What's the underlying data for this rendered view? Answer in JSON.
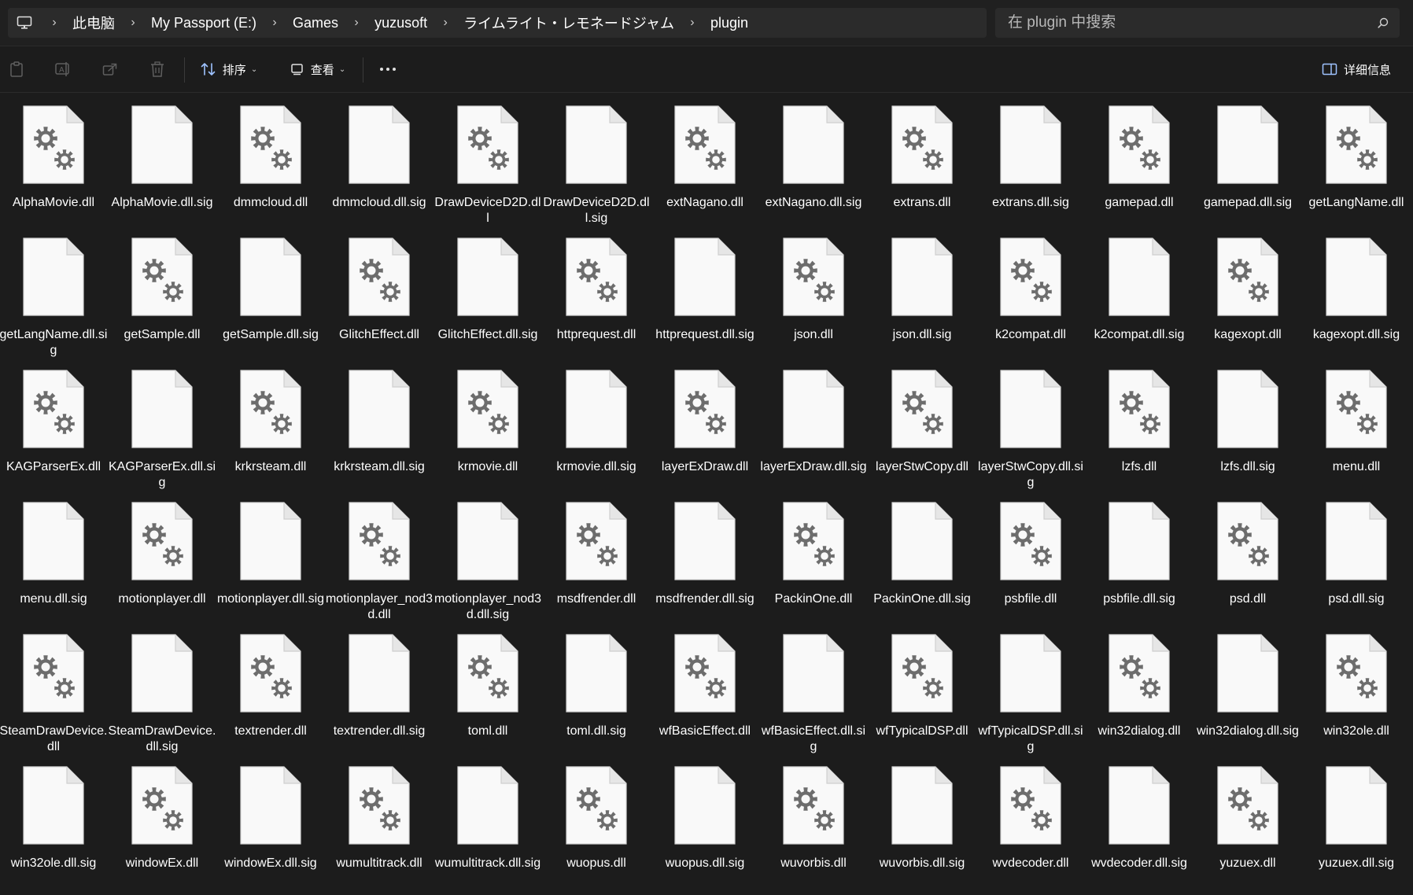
{
  "breadcrumb": [
    "此电脑",
    "My Passport (E:)",
    "Games",
    "yuzusoft",
    "ライムライト・レモネードジャム",
    "plugin"
  ],
  "search": {
    "placeholder": "在 plugin 中搜索"
  },
  "toolbar": {
    "sort_label": "排序",
    "view_label": "查看",
    "details_label": "详细信息"
  },
  "files": [
    {
      "name": "AlphaMovie.dll",
      "type": "dll"
    },
    {
      "name": "AlphaMovie.dll.sig",
      "type": "sig"
    },
    {
      "name": "dmmcloud.dll",
      "type": "dll"
    },
    {
      "name": "dmmcloud.dll.sig",
      "type": "sig"
    },
    {
      "name": "DrawDeviceD2D.dll",
      "type": "dll"
    },
    {
      "name": "DrawDeviceD2D.dll.sig",
      "type": "sig"
    },
    {
      "name": "extNagano.dll",
      "type": "dll"
    },
    {
      "name": "extNagano.dll.sig",
      "type": "sig"
    },
    {
      "name": "extrans.dll",
      "type": "dll"
    },
    {
      "name": "extrans.dll.sig",
      "type": "sig"
    },
    {
      "name": "gamepad.dll",
      "type": "dll"
    },
    {
      "name": "gamepad.dll.sig",
      "type": "sig"
    },
    {
      "name": "getLangName.dll",
      "type": "dll"
    },
    {
      "name": "getLangName.dll.sig",
      "type": "sig"
    },
    {
      "name": "getSample.dll",
      "type": "dll"
    },
    {
      "name": "getSample.dll.sig",
      "type": "sig"
    },
    {
      "name": "GlitchEffect.dll",
      "type": "dll"
    },
    {
      "name": "GlitchEffect.dll.sig",
      "type": "sig"
    },
    {
      "name": "httprequest.dll",
      "type": "dll"
    },
    {
      "name": "httprequest.dll.sig",
      "type": "sig"
    },
    {
      "name": "json.dll",
      "type": "dll"
    },
    {
      "name": "json.dll.sig",
      "type": "sig"
    },
    {
      "name": "k2compat.dll",
      "type": "dll"
    },
    {
      "name": "k2compat.dll.sig",
      "type": "sig"
    },
    {
      "name": "kagexopt.dll",
      "type": "dll"
    },
    {
      "name": "kagexopt.dll.sig",
      "type": "sig"
    },
    {
      "name": "KAGParserEx.dll",
      "type": "dll"
    },
    {
      "name": "KAGParserEx.dll.sig",
      "type": "sig"
    },
    {
      "name": "krkrsteam.dll",
      "type": "dll"
    },
    {
      "name": "krkrsteam.dll.sig",
      "type": "sig"
    },
    {
      "name": "krmovie.dll",
      "type": "dll"
    },
    {
      "name": "krmovie.dll.sig",
      "type": "sig"
    },
    {
      "name": "layerExDraw.dll",
      "type": "dll"
    },
    {
      "name": "layerExDraw.dll.sig",
      "type": "sig"
    },
    {
      "name": "layerStwCopy.dll",
      "type": "dll"
    },
    {
      "name": "layerStwCopy.dll.sig",
      "type": "sig"
    },
    {
      "name": "lzfs.dll",
      "type": "dll"
    },
    {
      "name": "lzfs.dll.sig",
      "type": "sig"
    },
    {
      "name": "menu.dll",
      "type": "dll"
    },
    {
      "name": "menu.dll.sig",
      "type": "sig"
    },
    {
      "name": "motionplayer.dll",
      "type": "dll"
    },
    {
      "name": "motionplayer.dll.sig",
      "type": "sig"
    },
    {
      "name": "motionplayer_nod3d.dll",
      "type": "dll"
    },
    {
      "name": "motionplayer_nod3d.dll.sig",
      "type": "sig"
    },
    {
      "name": "msdfrender.dll",
      "type": "dll"
    },
    {
      "name": "msdfrender.dll.sig",
      "type": "sig"
    },
    {
      "name": "PackinOne.dll",
      "type": "dll"
    },
    {
      "name": "PackinOne.dll.sig",
      "type": "sig"
    },
    {
      "name": "psbfile.dll",
      "type": "dll"
    },
    {
      "name": "psbfile.dll.sig",
      "type": "sig"
    },
    {
      "name": "psd.dll",
      "type": "dll"
    },
    {
      "name": "psd.dll.sig",
      "type": "sig"
    },
    {
      "name": "SteamDrawDevice.dll",
      "type": "dll"
    },
    {
      "name": "SteamDrawDevice.dll.sig",
      "type": "sig"
    },
    {
      "name": "textrender.dll",
      "type": "dll"
    },
    {
      "name": "textrender.dll.sig",
      "type": "sig"
    },
    {
      "name": "toml.dll",
      "type": "dll"
    },
    {
      "name": "toml.dll.sig",
      "type": "sig"
    },
    {
      "name": "wfBasicEffect.dll",
      "type": "dll"
    },
    {
      "name": "wfBasicEffect.dll.sig",
      "type": "sig"
    },
    {
      "name": "wfTypicalDSP.dll",
      "type": "dll"
    },
    {
      "name": "wfTypicalDSP.dll.sig",
      "type": "sig"
    },
    {
      "name": "win32dialog.dll",
      "type": "dll"
    },
    {
      "name": "win32dialog.dll.sig",
      "type": "sig"
    },
    {
      "name": "win32ole.dll",
      "type": "dll"
    },
    {
      "name": "win32ole.dll.sig",
      "type": "sig"
    },
    {
      "name": "windowEx.dll",
      "type": "dll"
    },
    {
      "name": "windowEx.dll.sig",
      "type": "sig"
    },
    {
      "name": "wumultitrack.dll",
      "type": "dll"
    },
    {
      "name": "wumultitrack.dll.sig",
      "type": "sig"
    },
    {
      "name": "wuopus.dll",
      "type": "dll"
    },
    {
      "name": "wuopus.dll.sig",
      "type": "sig"
    },
    {
      "name": "wuvorbis.dll",
      "type": "dll"
    },
    {
      "name": "wuvorbis.dll.sig",
      "type": "sig"
    },
    {
      "name": "wvdecoder.dll",
      "type": "dll"
    },
    {
      "name": "wvdecoder.dll.sig",
      "type": "sig"
    },
    {
      "name": "yuzuex.dll",
      "type": "dll"
    },
    {
      "name": "yuzuex.dll.sig",
      "type": "sig"
    }
  ],
  "icons": {
    "dll": "settings-file-icon",
    "sig": "blank-file-icon"
  },
  "colors": {
    "background": "#1c1c1c",
    "file_page": "#f9f9f9",
    "gear": "#6d6d6d"
  }
}
